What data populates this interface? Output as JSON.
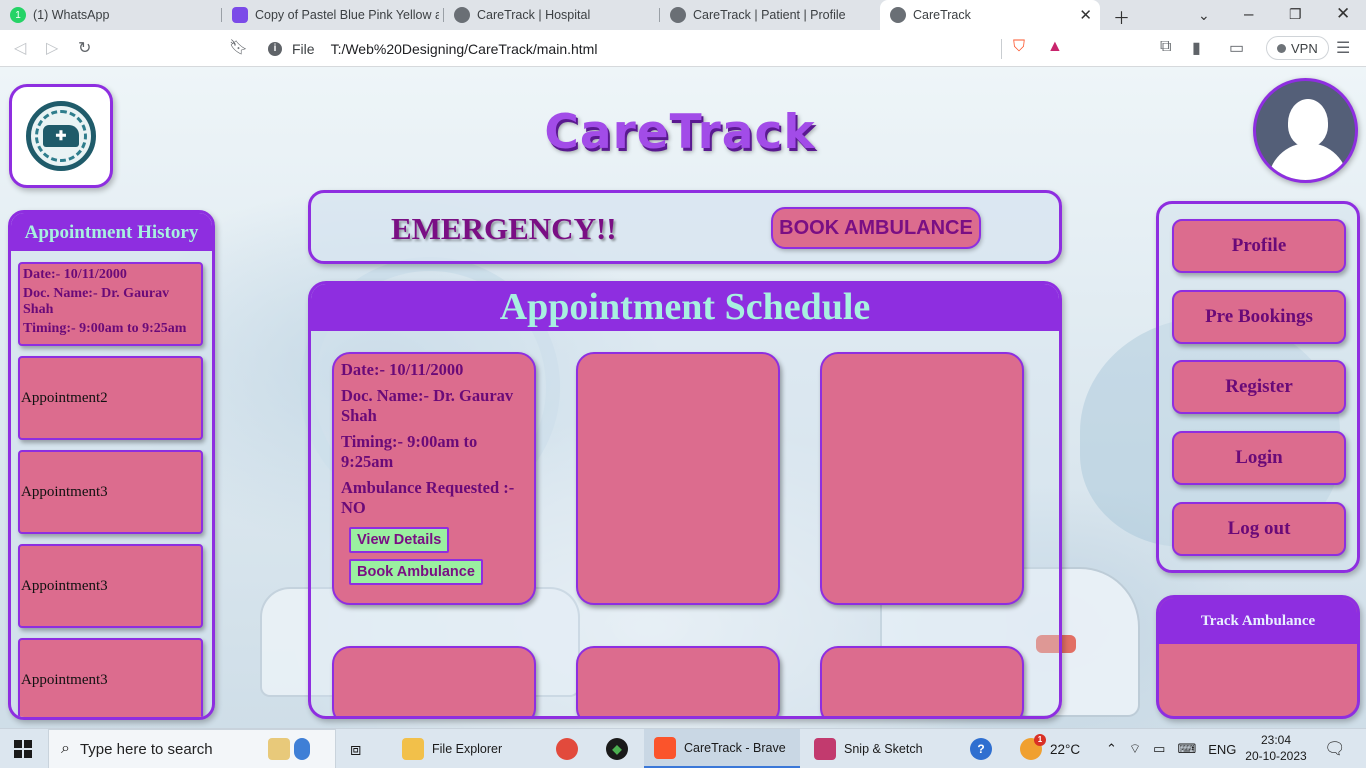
{
  "browser": {
    "tabs": [
      {
        "title": "(1) WhatsApp",
        "active": false
      },
      {
        "title": "Copy of Pastel Blue Pink Yellow an",
        "active": false
      },
      {
        "title": "CareTrack | Hospital",
        "active": false
      },
      {
        "title": "CareTrack | Patient | Profile",
        "active": false
      },
      {
        "title": "CareTrack",
        "active": true
      }
    ],
    "url_scheme": "File",
    "url": "T:/Web%20Designing/CareTrack/main.html",
    "vpn_label": "VPN"
  },
  "page": {
    "brand": "CareTrack",
    "history": {
      "title": "Appointment History",
      "detail": {
        "date": "Date:- 10/11/2000",
        "doctor": "Doc. Name:- Dr. Gaurav Shah",
        "timing": "Timing:- 9:00am to 9:25am"
      },
      "items": [
        "Appointment2",
        "Appointment3",
        "Appointment3",
        "Appointment3"
      ]
    },
    "emergency": {
      "text": "EMERGENCY!!",
      "button": "BOOK AMBULANCE"
    },
    "schedule": {
      "title": "Appointment Schedule",
      "card": {
        "date": "Date:- 10/11/2000",
        "doctor": "Doc. Name:- Dr. Gaurav Shah",
        "timing": "Timing:- 9:00am to 9:25am",
        "ambulance": "Ambulance Requested :- NO",
        "view_btn": "View Details",
        "book_btn": "Book Ambulance"
      }
    },
    "nav": [
      "Profile",
      "Pre Bookings",
      "Register",
      "Login",
      "Log out"
    ],
    "track": {
      "title": "Track Ambulance"
    },
    "colors": {
      "accent": "#8e2ee0",
      "card": "#dc6c8e",
      "title_text": "#a8f0e0",
      "label_text": "#6a0a78"
    }
  },
  "taskbar": {
    "search_placeholder": "Type here to search",
    "apps": [
      {
        "label": "File Explorer"
      },
      {
        "label": "CareTrack - Brave",
        "active": true
      },
      {
        "label": "Snip & Sketch"
      }
    ],
    "weather": "22°C",
    "language": "ENG",
    "time": "23:04",
    "date": "20-10-2023",
    "notification_badge": "1"
  }
}
